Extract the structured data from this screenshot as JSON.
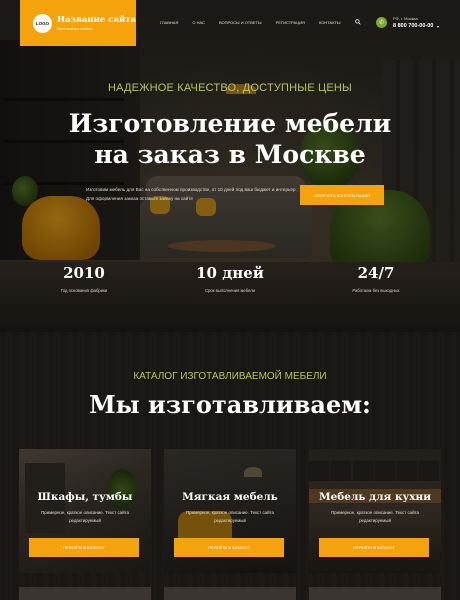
{
  "header": {
    "logo_text": "LOGO",
    "site_name": "Название сайта",
    "site_subtitle": "Изготовление мебели",
    "nav": [
      "ГЛАВНАЯ",
      "О НАС",
      "ВОПРОСЫ И ОТВЕТЫ",
      "РЕГИСТРАЦИЯ",
      "КОНТАКТЫ"
    ],
    "city": "РФ, г. Москва",
    "phone": "8 800 700-00-00",
    "icons": {
      "search": "search-icon",
      "phone": "phone-icon",
      "dropdown": "chevron-down-icon"
    },
    "accent_color": "#f5a30c"
  },
  "hero": {
    "tagline": "НАДЕЖНОЕ КАЧЕСТВО, ДОСТУПНЫЕ ЦЕНЫ",
    "title_line1": "Изготовление мебели",
    "title_line2": "на заказ в Москве",
    "description": "Изготовим мебель для Вас на собственном производстве, от 10 дней под ваш бюджет и интерьер. Для оформления заказа оставьте заявку на сайте",
    "cta_label": "ПОЛУЧИТЬ КОНСУЛЬТАЦИЮ",
    "stats": [
      {
        "value": "2010",
        "label": "Год основания фабрики"
      },
      {
        "value": "10 дней",
        "label": "Срок выполнения мебели"
      },
      {
        "value": "24/7",
        "label": "Работаем без выходных"
      }
    ]
  },
  "catalog": {
    "tagline": "КАТАЛОГ ИЗГОТАВЛИВАЕМОЙ МЕБЕЛИ",
    "title": "Мы изготавливаем:",
    "cards": [
      {
        "title": "Шкафы, тумбы",
        "description": "Примерное, краткое описание. Текст сайта редактируемый",
        "button": "ПЕРЕЙТИ В КАТАЛОГ"
      },
      {
        "title": "Мягкая мебель",
        "description": "Примерное, краткое описание. Текст сайта редактируемый",
        "button": "ПЕРЕЙТИ В КАТАЛОГ"
      },
      {
        "title": "Мебель для кухни",
        "description": "Примерное, краткое описание. Текст сайта редактируемый",
        "button": "ПЕРЕЙТИ В КАТАЛОГ"
      }
    ]
  }
}
